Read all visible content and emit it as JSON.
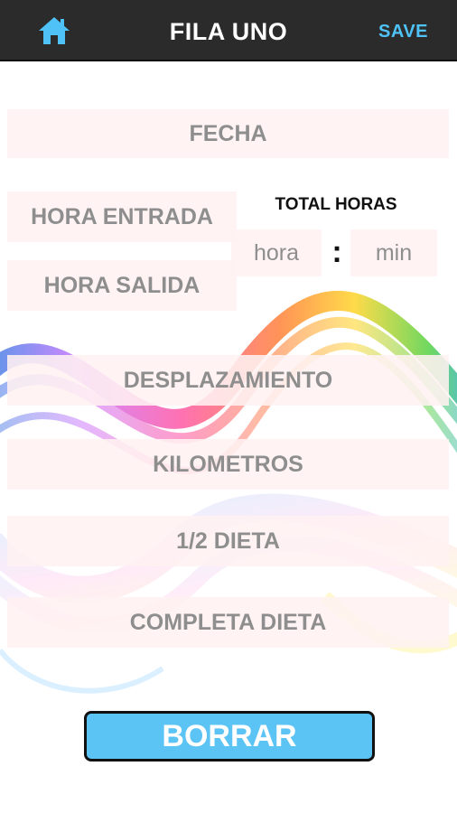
{
  "header": {
    "title": "FILA UNO",
    "save_label": "SAVE",
    "home_icon": "home-icon",
    "accent_color": "#4fc3f7",
    "bar_color": "#2b2b2b"
  },
  "form": {
    "fecha": "FECHA",
    "hora_entrada": "HORA ENTRADA",
    "hora_salida": "HORA SALIDA",
    "total_horas_label": "TOTAL HORAS",
    "hora_placeholder": "hora",
    "separator": ":",
    "min_placeholder": "min",
    "desplazamiento": "DESPLAZAMIENTO",
    "kilometros": "KILOMETROS",
    "media_dieta": "1/2 DIETA",
    "completa_dieta": "COMPLETA DIETA"
  },
  "actions": {
    "borrar_label": "BORRAR",
    "borrar_color": "#5cc3f5"
  }
}
